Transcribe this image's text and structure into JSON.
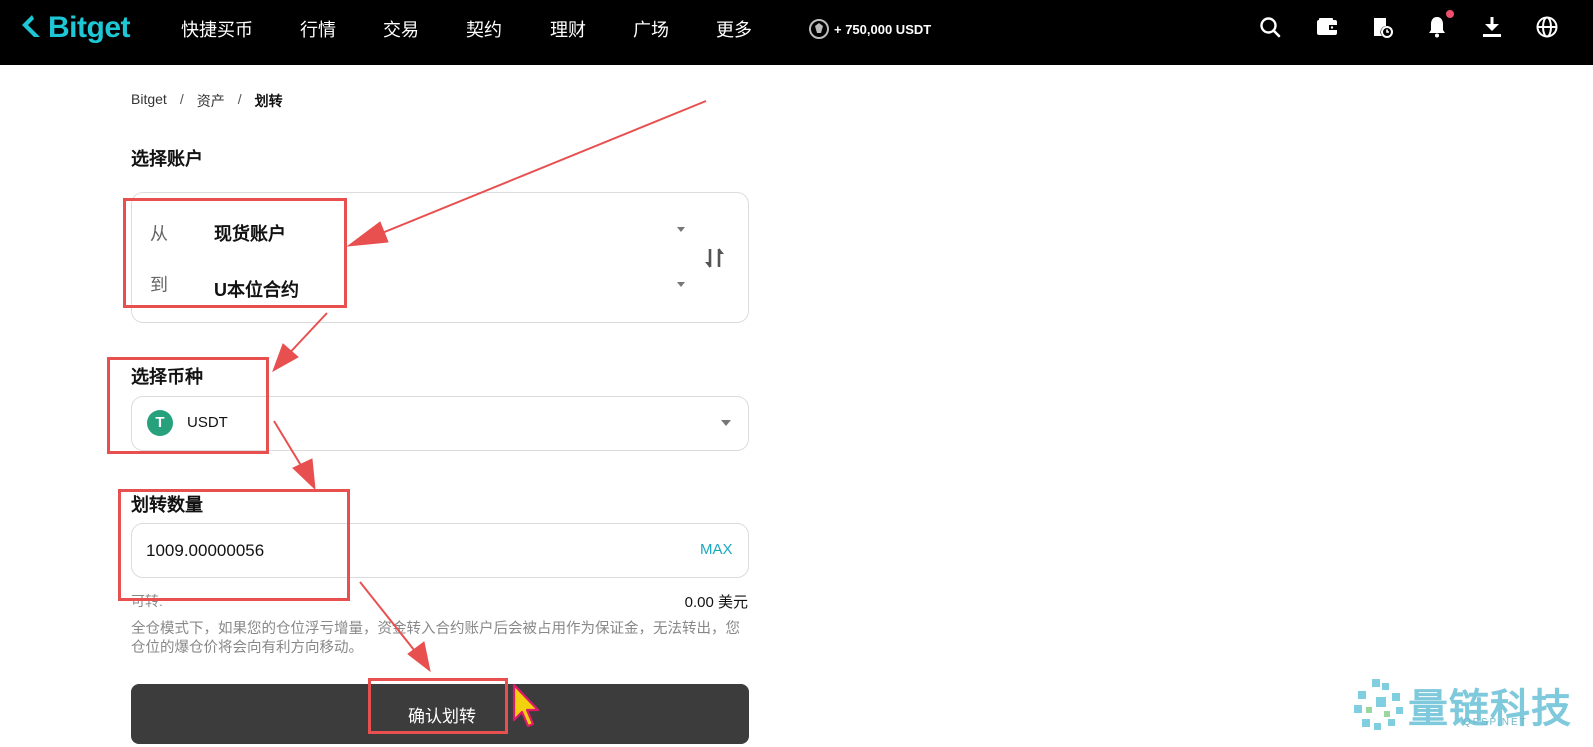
{
  "brand": {
    "name": "Bitget",
    "accent": "#1ec7d6"
  },
  "nav": {
    "items": [
      "快捷买币",
      "行情",
      "交易",
      "契约",
      "理财",
      "广场",
      "更多"
    ],
    "promo": "+ 750,000 USDT",
    "icons": [
      "search-icon",
      "wallet-icon",
      "order-history-icon",
      "bell-icon",
      "download-icon",
      "globe-icon"
    ]
  },
  "breadcrumb": {
    "root": "Bitget",
    "sep": "/",
    "level1": "资产",
    "current": "划转"
  },
  "account": {
    "title": "选择账户",
    "from_label": "从",
    "from_value": "现货账户",
    "to_label": "到",
    "to_value": "U本位合约"
  },
  "coin": {
    "title": "选择币种",
    "symbol": "USDT",
    "icon_glyph": "T",
    "icon_color": "#26a17b"
  },
  "amount": {
    "title": "划转数量",
    "value": "1009.00000056",
    "max_label": "MAX",
    "available_label": "可转:",
    "available_value": "0.00 美元"
  },
  "note": "全仓模式下，如果您的仓位浮亏增量，资金转入合约账户后会被占用作为保证金，无法转出，您仓位的爆仓价将会向有利方向移动。",
  "confirm_label": "确认划转",
  "watermark": {
    "text": "量链科技",
    "sub": "QFSP.NET"
  },
  "annotation_color": "#e85050"
}
